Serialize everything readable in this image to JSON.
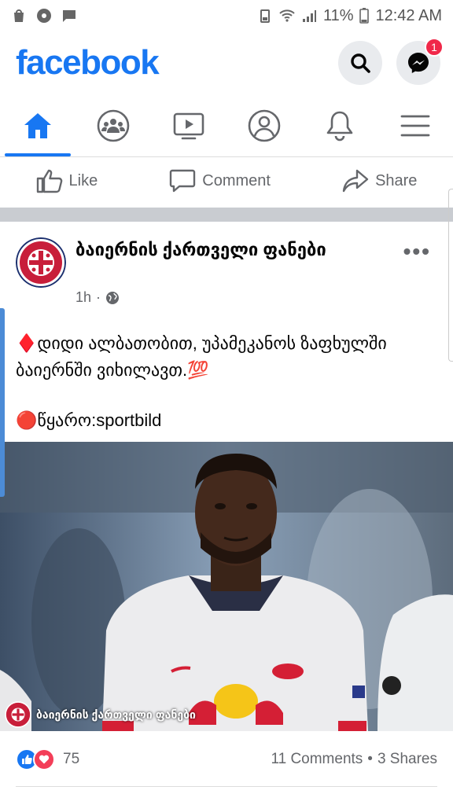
{
  "status_bar": {
    "battery": "11%",
    "time": "12:42 AM"
  },
  "header": {
    "logo": "facebook",
    "messenger_badge": "1"
  },
  "nav": {
    "tabs": [
      "home-icon",
      "groups-icon",
      "watch-icon",
      "profile-icon",
      "notifications-icon",
      "menu-icon"
    ],
    "active": "home-icon",
    "accent": "#1877f2"
  },
  "actions": {
    "like": "Like",
    "comment": "Comment",
    "share": "Share"
  },
  "post": {
    "author": "ბაიერნის ქართველი ფანები",
    "time": "1h",
    "privacy_icon": "globe-icon",
    "text_line1": "♦️დიდი ალბათობით, უპამეკანოს ზაფხულში ბაიერნში ვიხილავთ.💯",
    "source": "🔴წყარო:sportbild",
    "watermark": "ბაიერნის ქართველი ფანები"
  },
  "reactions": {
    "count": "75",
    "comments": "11 Comments",
    "shares": "3 Shares",
    "separator": "•"
  }
}
